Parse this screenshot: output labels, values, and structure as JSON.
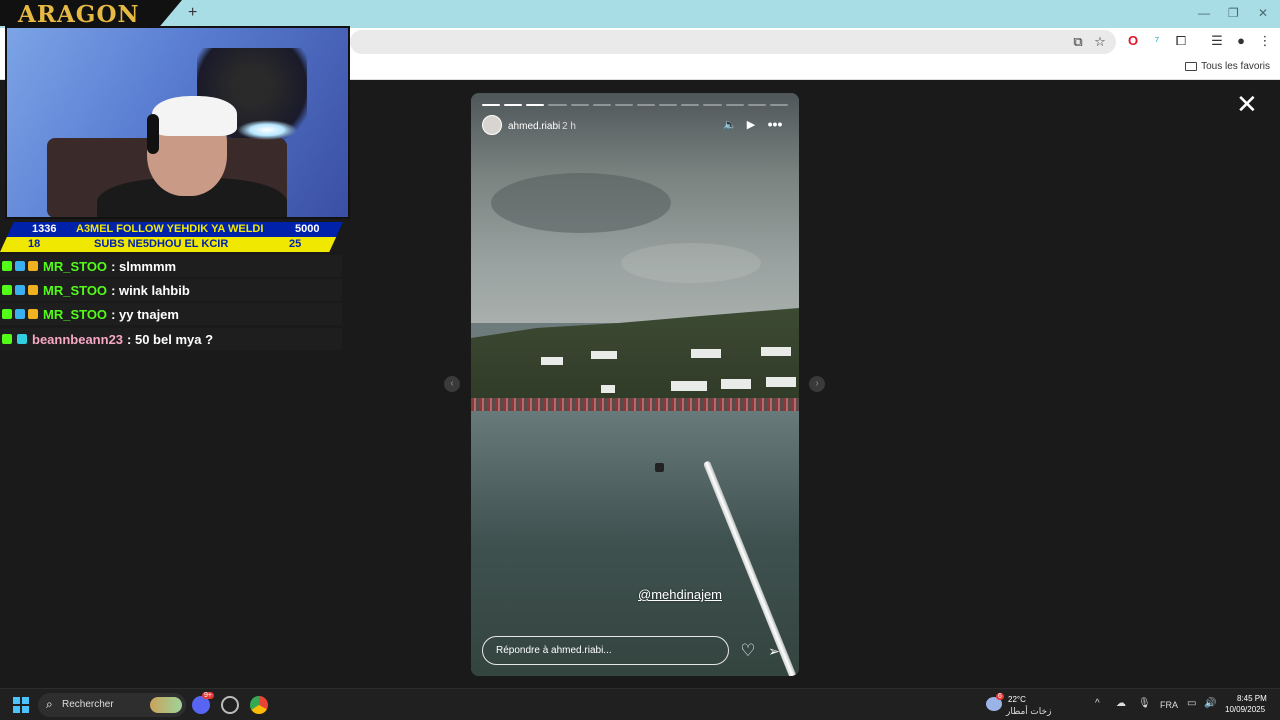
{
  "browser": {
    "new_tab": "+",
    "bookmarks_folder": "Tous les favoris"
  },
  "stream": {
    "logo": "ARAGON",
    "banner": {
      "count_left": "1336",
      "headline": "A3MEL FOLLOW YEHDIK YA WELDI",
      "count_right": "5000",
      "subs_left": "18",
      "subs_text": "SUBS NE5DHOU EL KCIR",
      "subs_right": "25"
    },
    "chat": [
      {
        "user": "MR_STOO",
        "message": ": slmmmm"
      },
      {
        "user": "MR_STOO",
        "message": ": wink lahbib"
      },
      {
        "user": "MR_STOO",
        "message": ": yy tnajem"
      },
      {
        "user": "beannbeann23",
        "message": ": 50 bel mya ?"
      }
    ]
  },
  "story": {
    "username": "ahmed.riabi",
    "time": "2 h",
    "mention": "@mehdinajem",
    "reply_placeholder": "Répondre à ahmed.riabi...",
    "segments_total": 14,
    "segments_done": 3,
    "close_glyph": "✕"
  },
  "taskbar": {
    "search_label": "Rechercher",
    "weather_temp": "22°C",
    "weather_desc": "زخات أمطار",
    "weather_badge": "6",
    "language": "FRA",
    "time": "8:45 PM",
    "date": "10/09/2025",
    "discord_badge": "9+"
  },
  "icons": {
    "close": "close-icon",
    "mute": "volume-icon",
    "play": "play-icon",
    "more": "more-icon",
    "like": "heart-icon",
    "send": "send-icon"
  }
}
